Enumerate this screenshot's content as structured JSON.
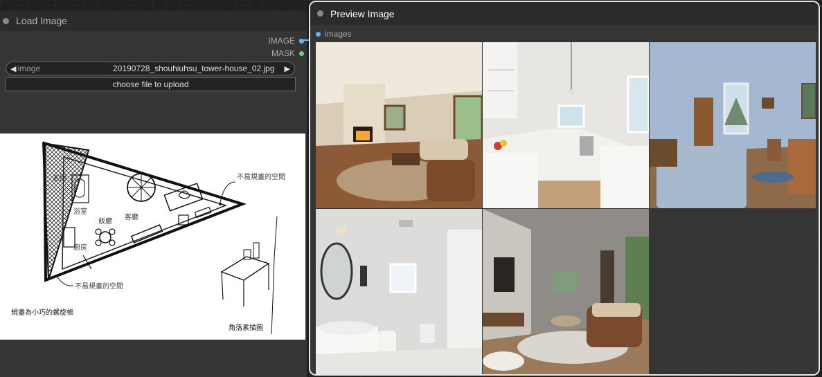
{
  "load_node": {
    "title": "Load Image",
    "outputs": [
      {
        "label": "IMAGE",
        "color": "#64b5f6"
      },
      {
        "label": "MASK",
        "color": "#81c784"
      }
    ],
    "image_widget": {
      "label": "image",
      "value": "20190728_shouhiuhsu_tower-house_02.jpg"
    },
    "upload_label": "choose file to upload",
    "sketch_labels": {
      "entrance": "玄關",
      "bath": "浴室",
      "dining": "飯廳",
      "living": "客廳",
      "kitchen": "廚房",
      "unplanned_top": "不易規畫的空間",
      "unplanned_bottom": "不易規畫的空間",
      "stair_note": "規畫為小巧的螺旋梯",
      "corner_sketch": "角落素描圖"
    }
  },
  "preview_node": {
    "title": "Preview Image",
    "input": {
      "label": "images",
      "color": "#64b5f6"
    }
  },
  "colors": {
    "canvas_bg": "#1f1f1f",
    "node_bg": "#353535",
    "header_bg": "#2b2b2b",
    "image_slot": "#64b5f6",
    "mask_slot": "#81c784",
    "selected_border": "#e8e8e8"
  }
}
